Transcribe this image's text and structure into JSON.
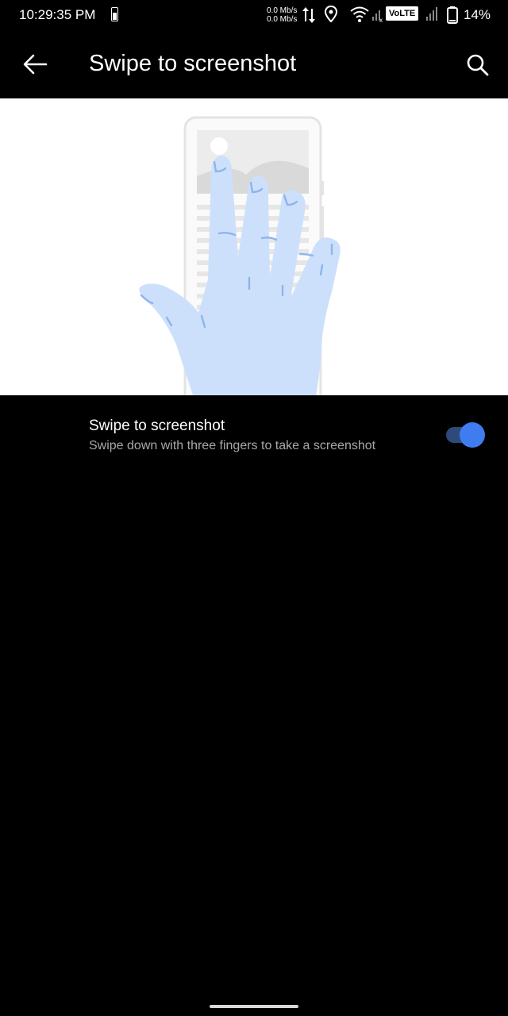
{
  "status_bar": {
    "time": "10:29:35 PM",
    "speed_up": "0.0 Mb/s",
    "speed_down": "0.0 Mb/s",
    "network_badge": "VoLTE",
    "battery_percent": "14%",
    "icons": [
      "battery-saver-icon",
      "data-arrows-icon",
      "location-icon",
      "wifi-icon",
      "mobile-signal-icon",
      "mobile-signal-icon",
      "battery-icon"
    ]
  },
  "app_bar": {
    "title": "Swipe to screenshot",
    "back_icon": "arrow-back-icon",
    "search_icon": "search-icon"
  },
  "setting": {
    "title": "Swipe to screenshot",
    "subtitle": "Swipe down with three fingers to take a screenshot",
    "enabled": true
  },
  "colors": {
    "accent": "#3f7cf0",
    "hand": "#cde0fb",
    "hand_lines": "#8fb4ec"
  }
}
